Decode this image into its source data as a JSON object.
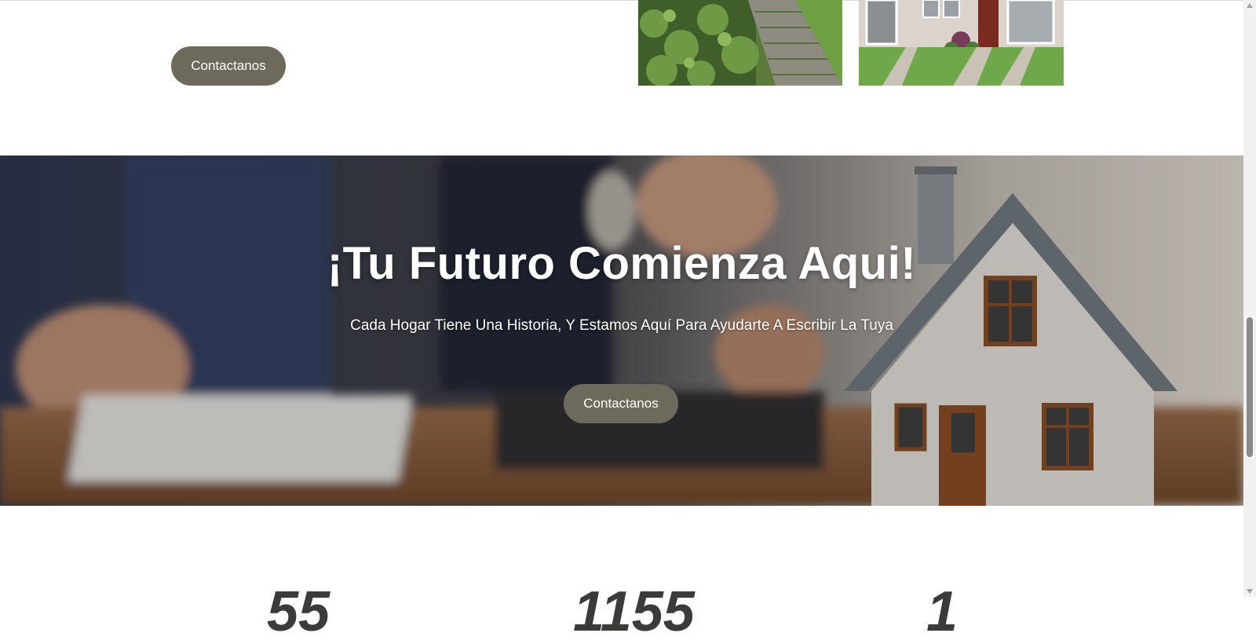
{
  "top_section": {
    "contact_button_label": "Contactanos",
    "gallery": [
      {
        "name": "garden-path-photo",
        "description_icon": "image-icon"
      },
      {
        "name": "house-front-photo",
        "description_icon": "image-icon"
      }
    ]
  },
  "hero": {
    "title": "¡Tu Futuro Comienza Aqui!",
    "subtitle": "Cada Hogar Tiene Una Historia, Y Estamos Aquí Para Ayudarte A Escribir La Tuya",
    "contact_button_label": "Contactanos"
  },
  "stats": {
    "values": [
      "55",
      "1155",
      "1"
    ]
  },
  "colors": {
    "button_bg": "#6e6a5b",
    "button_text": "#ffffff",
    "hero_text": "#ffffff",
    "stats_text": "#3c3b39"
  },
  "scrollbar": {
    "icons": [
      "scroll-up-arrow-icon",
      "scroll-down-arrow-icon"
    ]
  }
}
